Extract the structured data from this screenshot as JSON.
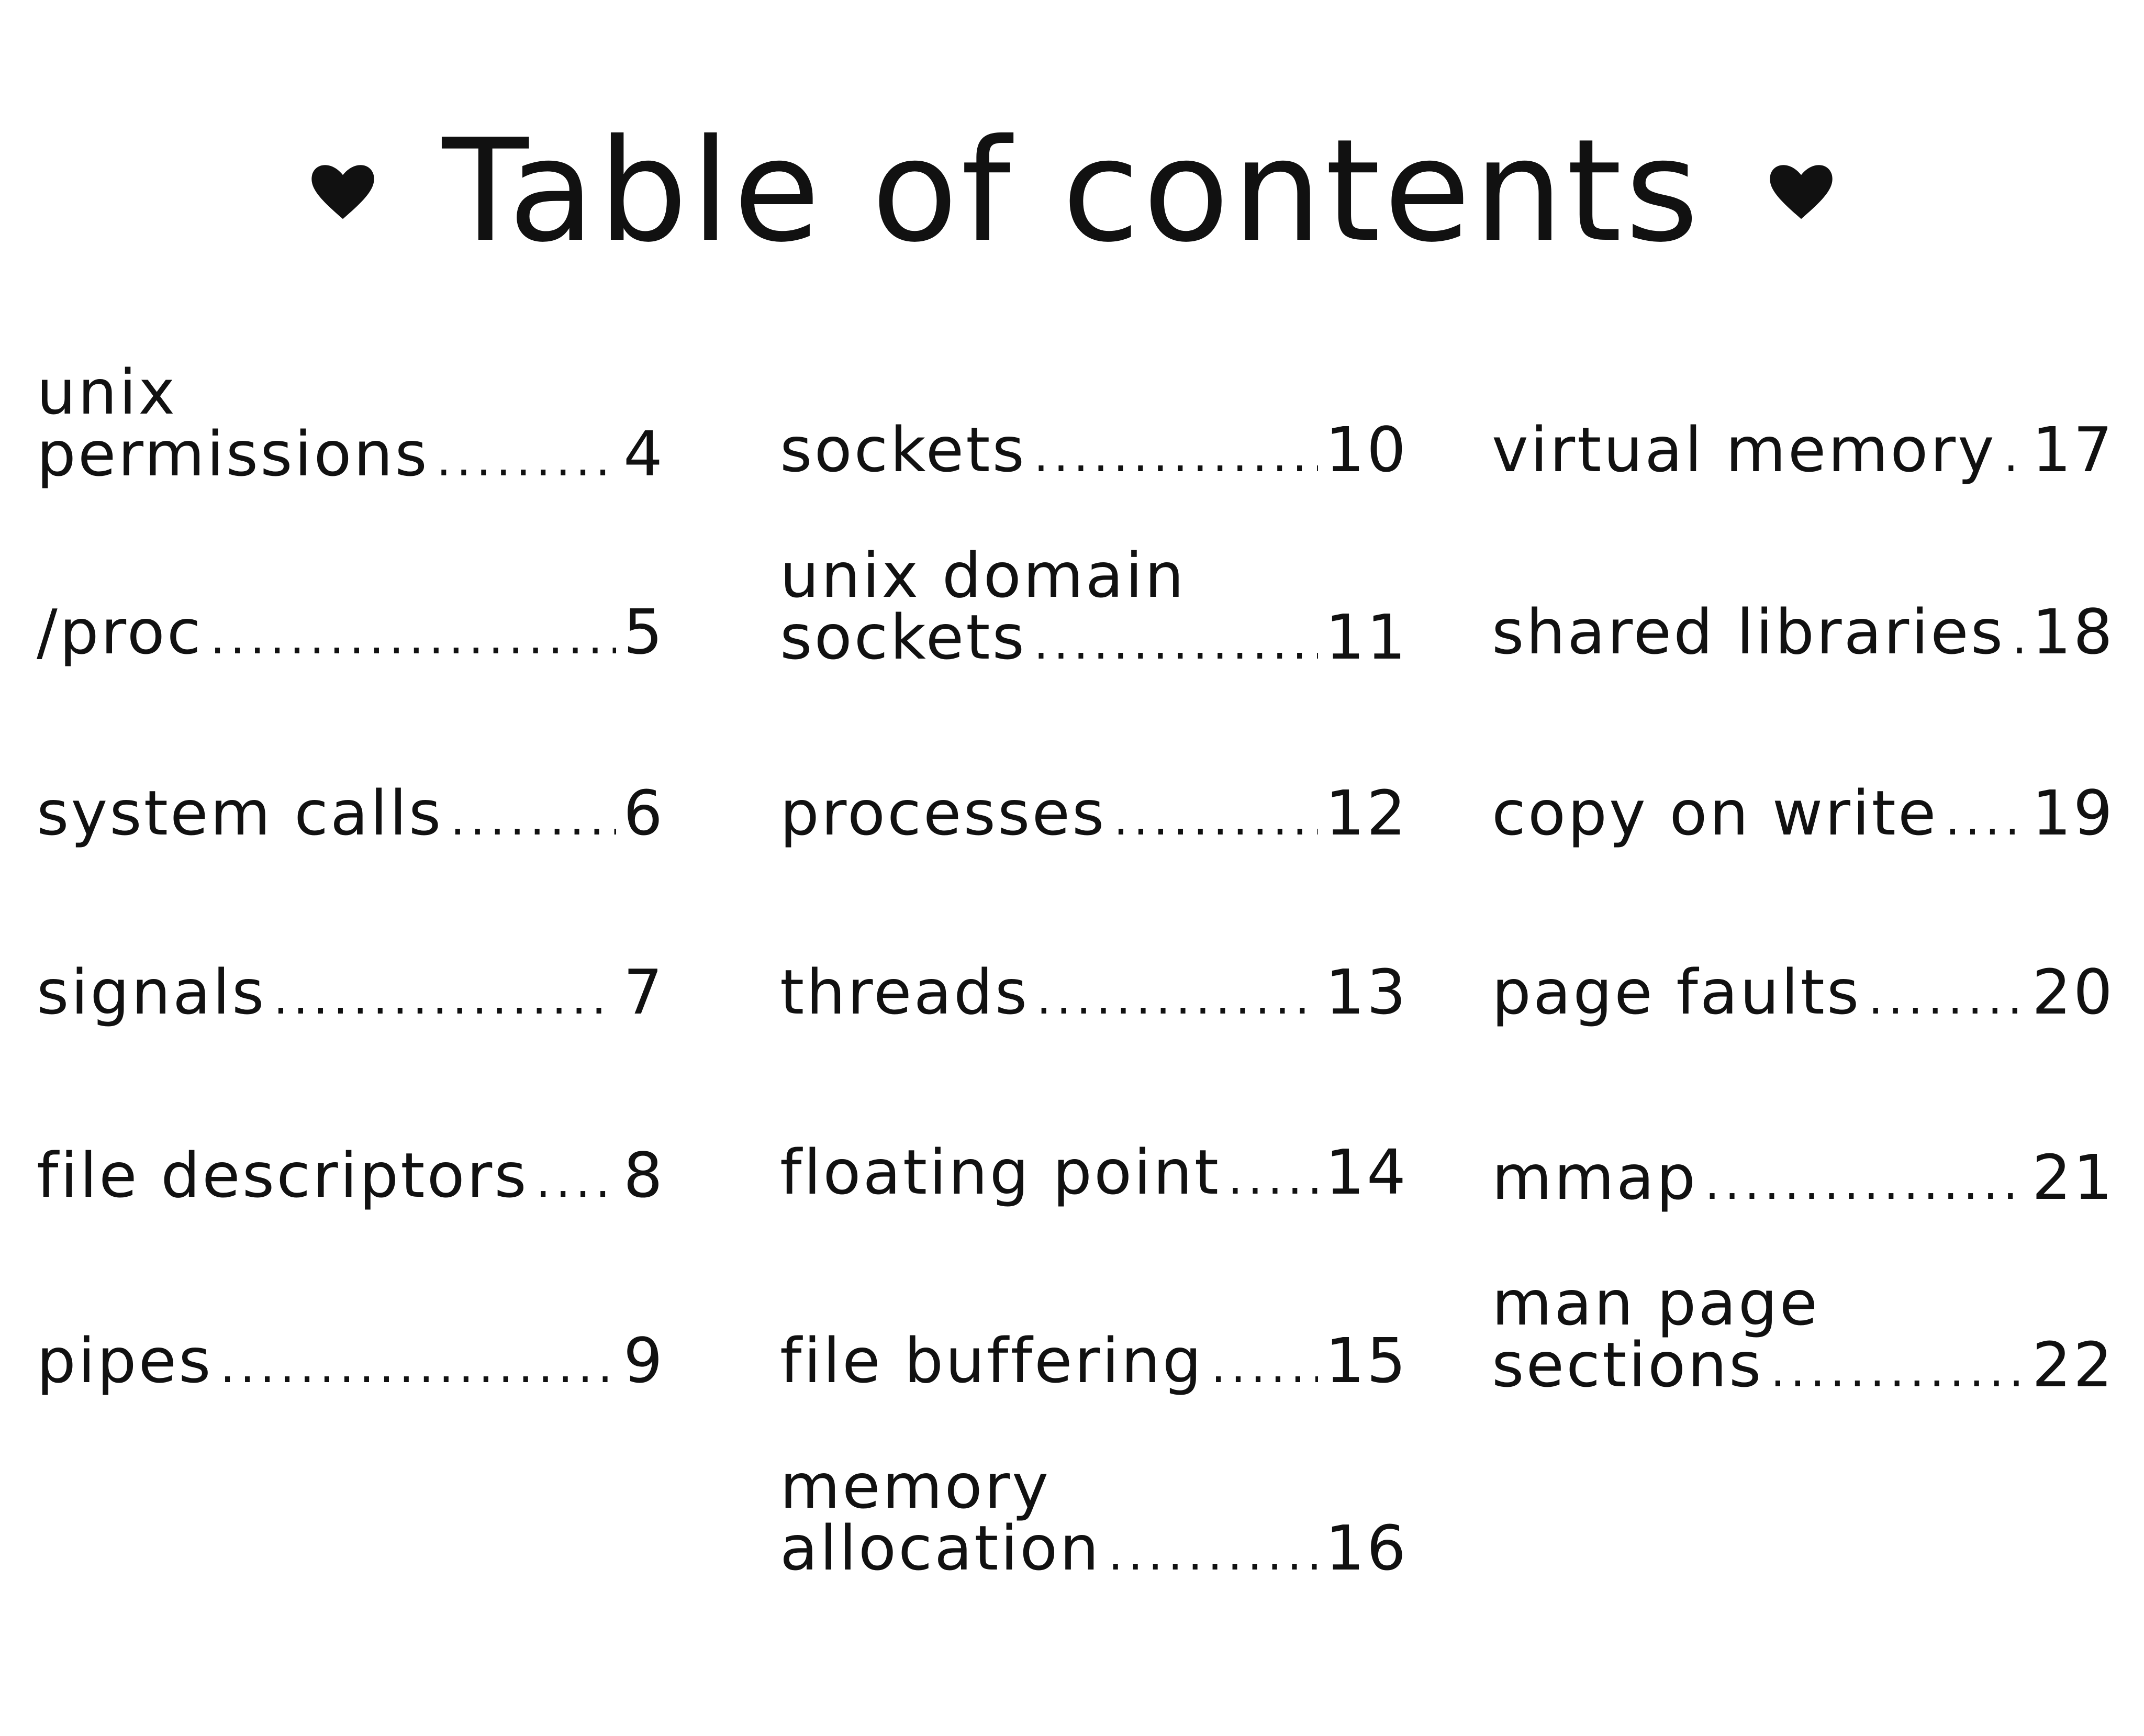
{
  "title": "Table of contents",
  "heart_icon": "heart-icon",
  "dot_leader": "................................................................................................",
  "columns": [
    {
      "entries": [
        {
          "line1": "unix",
          "label": "permissions",
          "page": "4"
        },
        {
          "line1": "",
          "label": "/proc",
          "page": "5"
        },
        {
          "line1": "",
          "label": "system calls",
          "page": "6"
        },
        {
          "line1": "",
          "label": "signals",
          "page": "7"
        },
        {
          "line1": "",
          "label": "file descriptors",
          "page": "8"
        },
        {
          "line1": "",
          "label": "pipes",
          "page": "9"
        }
      ]
    },
    {
      "entries": [
        {
          "line1": "",
          "label": "sockets",
          "page": "10"
        },
        {
          "line1": "unix domain",
          "label": "sockets",
          "page": "11"
        },
        {
          "line1": "",
          "label": "processes",
          "page": "12"
        },
        {
          "line1": "",
          "label": "threads",
          "page": "13"
        },
        {
          "line1": "",
          "label": "floating point",
          "page": "14"
        },
        {
          "line1": "",
          "label": "file buffering",
          "page": "15"
        },
        {
          "line1": "memory",
          "label": "allocation",
          "page": "16"
        }
      ]
    },
    {
      "entries": [
        {
          "line1": "",
          "label": "virtual memory",
          "page": "17"
        },
        {
          "line1": "",
          "label": "shared libraries",
          "page": "18"
        },
        {
          "line1": "",
          "label": "copy on write",
          "page": "19"
        },
        {
          "line1": "",
          "label": "page faults",
          "page": "20"
        },
        {
          "line1": "",
          "label": "mmap",
          "page": "21"
        },
        {
          "line1": "man page",
          "label": "sections",
          "page": "22"
        }
      ]
    }
  ]
}
